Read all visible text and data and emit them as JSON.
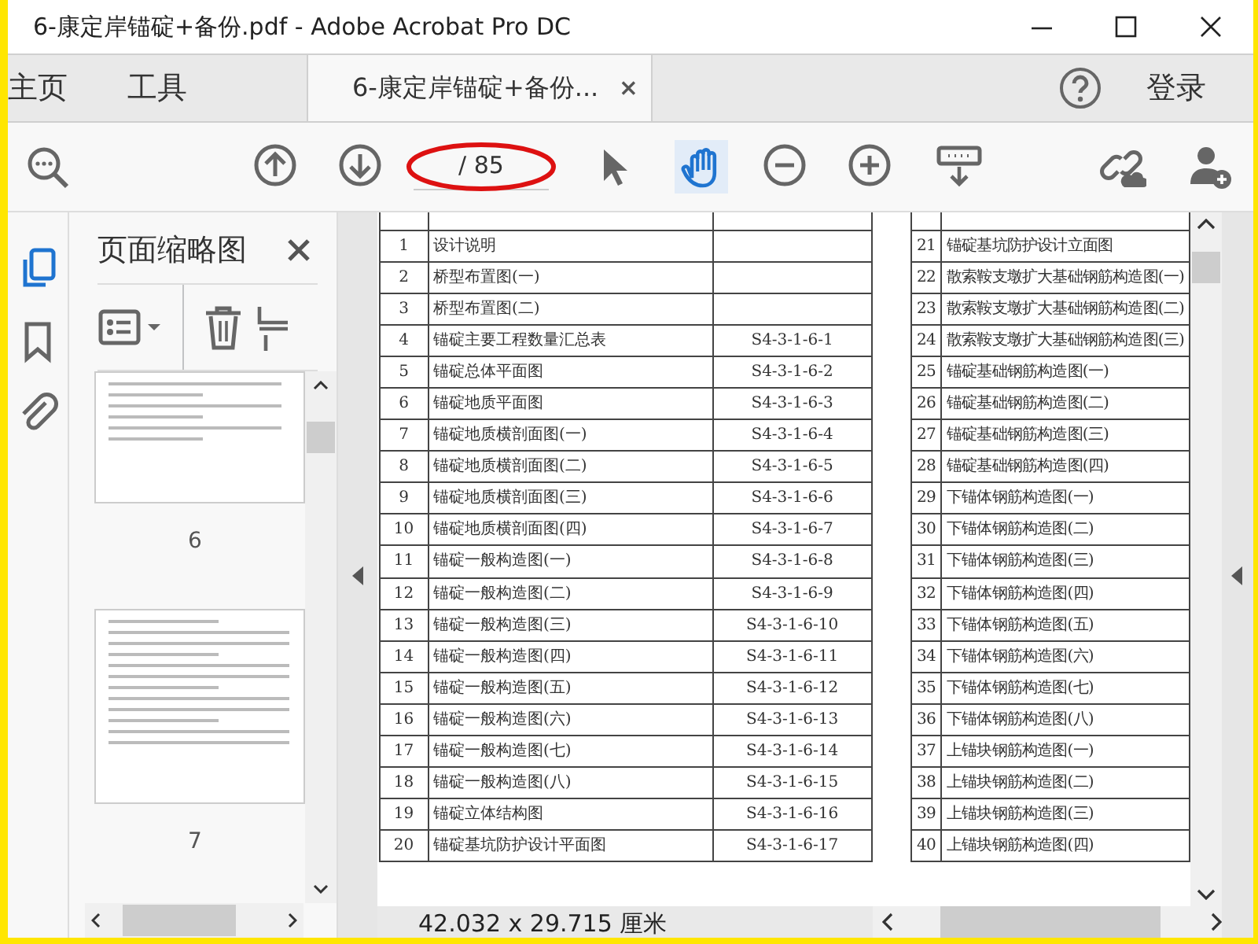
{
  "window": {
    "title": "6-康定岸锚碇+备份.pdf - Adobe Acrobat Pro DC"
  },
  "tabs": [
    {
      "label": "主页",
      "selected": false
    },
    {
      "label": "工具",
      "selected": false
    },
    {
      "label": "6-康定岸锚碇+备份...",
      "selected": true
    }
  ],
  "account": {
    "login": "登录"
  },
  "toolbar": {
    "page_total": "/ 85",
    "tools": [
      {
        "kind": "find",
        "selected": false
      },
      {
        "kind": "prev",
        "selected": false
      },
      {
        "kind": "next",
        "selected": false
      },
      {
        "kind": "pointer",
        "selected": false
      },
      {
        "kind": "hand",
        "selected": true
      },
      {
        "kind": "zoom-out",
        "selected": false
      },
      {
        "kind": "zoom-in",
        "selected": false
      },
      {
        "kind": "keyboard",
        "selected": false
      },
      {
        "kind": "link",
        "selected": false
      },
      {
        "kind": "user-add",
        "selected": false
      }
    ]
  },
  "sidebar": {
    "rail": [
      {
        "kind": "pages",
        "selected": true
      },
      {
        "kind": "bookmark",
        "selected": false
      },
      {
        "kind": "attachment",
        "selected": false
      }
    ],
    "panel": {
      "title": "页面缩略图",
      "thumbnails": [
        {
          "label": "6",
          "kind": "drawing"
        },
        {
          "label": "7",
          "kind": "text"
        }
      ]
    }
  },
  "document": {
    "tables": [
      {
        "rows": [
          {
            "no": "1",
            "name": "设计说明"
          },
          {
            "no": "2",
            "name": "桥型布置图(一)"
          },
          {
            "no": "3",
            "name": "桥型布置图(二)"
          },
          {
            "no": "4",
            "name": "锚碇主要工程数量汇总表",
            "code": "S4-3-1-6-1"
          },
          {
            "no": "5",
            "name": "锚碇总体平面图",
            "code": "S4-3-1-6-2"
          },
          {
            "no": "6",
            "name": "锚碇地质平面图",
            "code": "S4-3-1-6-3"
          },
          {
            "no": "7",
            "name": "锚碇地质横剖面图(一)",
            "code": "S4-3-1-6-4"
          },
          {
            "no": "8",
            "name": "锚碇地质横剖面图(二)",
            "code": "S4-3-1-6-5"
          },
          {
            "no": "9",
            "name": "锚碇地质横剖面图(三)",
            "code": "S4-3-1-6-6"
          },
          {
            "no": "10",
            "name": "锚碇地质横剖面图(四)",
            "code": "S4-3-1-6-7"
          },
          {
            "no": "11",
            "name": "锚碇一般构造图(一)",
            "code": "S4-3-1-6-8"
          },
          {
            "no": "12",
            "name": "锚碇一般构造图(二)",
            "code": "S4-3-1-6-9"
          },
          {
            "no": "13",
            "name": "锚碇一般构造图(三)",
            "code": "S4-3-1-6-10"
          },
          {
            "no": "14",
            "name": "锚碇一般构造图(四)",
            "code": "S4-3-1-6-11"
          },
          {
            "no": "15",
            "name": "锚碇一般构造图(五)",
            "code": "S4-3-1-6-12"
          },
          {
            "no": "16",
            "name": "锚碇一般构造图(六)",
            "code": "S4-3-1-6-13"
          },
          {
            "no": "17",
            "name": "锚碇一般构造图(七)",
            "code": "S4-3-1-6-14"
          },
          {
            "no": "18",
            "name": "锚碇一般构造图(八)",
            "code": "S4-3-1-6-15"
          },
          {
            "no": "19",
            "name": "锚碇立体结构图",
            "code": "S4-3-1-6-16"
          },
          {
            "no": "20",
            "name": "锚碇基坑防护设计平面图",
            "code": "S4-3-1-6-17"
          }
        ]
      },
      {
        "rows": [
          {
            "no": "21",
            "name": "锚碇基坑防护设计立面图"
          },
          {
            "no": "22",
            "name": "散索鞍支墩扩大基础钢筋构造图(一)"
          },
          {
            "no": "23",
            "name": "散索鞍支墩扩大基础钢筋构造图(二)"
          },
          {
            "no": "24",
            "name": "散索鞍支墩扩大基础钢筋构造图(三)"
          },
          {
            "no": "25",
            "name": "锚碇基础钢筋构造图(一)"
          },
          {
            "no": "26",
            "name": "锚碇基础钢筋构造图(二)"
          },
          {
            "no": "27",
            "name": "锚碇基础钢筋构造图(三)"
          },
          {
            "no": "28",
            "name": "锚碇基础钢筋构造图(四)"
          },
          {
            "no": "29",
            "name": "下锚体钢筋构造图(一)"
          },
          {
            "no": "30",
            "name": "下锚体钢筋构造图(二)"
          },
          {
            "no": "31",
            "name": "下锚体钢筋构造图(三)"
          },
          {
            "no": "32",
            "name": "下锚体钢筋构造图(四)"
          },
          {
            "no": "33",
            "name": "下锚体钢筋构造图(五)"
          },
          {
            "no": "34",
            "name": "下锚体钢筋构造图(六)"
          },
          {
            "no": "35",
            "name": "下锚体钢筋构造图(七)"
          },
          {
            "no": "36",
            "name": "下锚体钢筋构造图(八)"
          },
          {
            "no": "37",
            "name": "上锚块钢筋构造图(一)"
          },
          {
            "no": "38",
            "name": "上锚块钢筋构造图(二)"
          },
          {
            "no": "39",
            "name": "上锚块钢筋构造图(三)"
          },
          {
            "no": "40",
            "name": "上锚块钢筋构造图(四)"
          }
        ]
      }
    ]
  },
  "status_bar": {
    "page_size": "42.032 x 29.715 厘米"
  }
}
